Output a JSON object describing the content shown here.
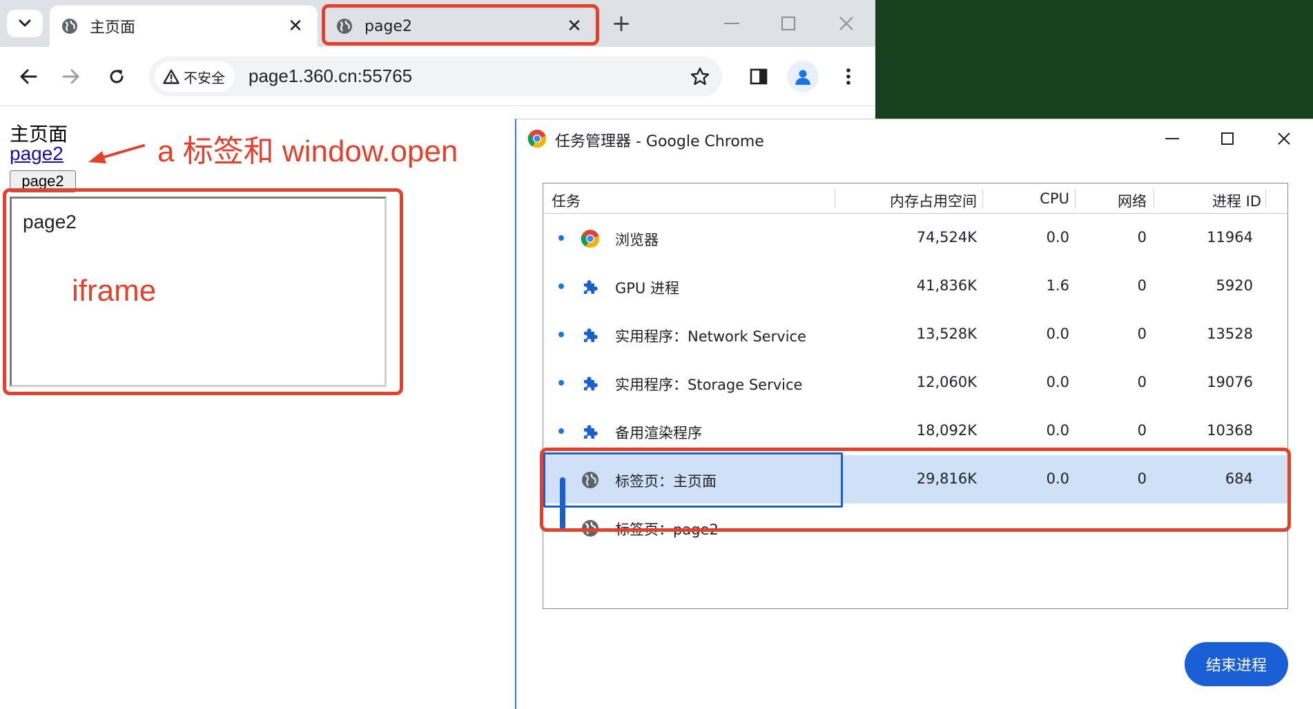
{
  "browser": {
    "tabs": [
      {
        "title": "主页面",
        "close": "✕"
      },
      {
        "title": "page2",
        "close": "✕"
      }
    ],
    "new_tab": "+",
    "security_label": "不安全",
    "url": "page1.360.cn:55765"
  },
  "page": {
    "heading": "主页面",
    "link_text": "page2",
    "button_label": "page2",
    "iframe_content": "page2"
  },
  "annotations": {
    "arrow_label": "a 标签和 window.open",
    "iframe_label": "iframe",
    "color": "#e2412c"
  },
  "task_manager": {
    "title": "任务管理器 - Google Chrome",
    "columns": [
      "任务",
      "内存占用空间",
      "CPU",
      "网络",
      "进程 ID"
    ],
    "rows": [
      {
        "icon": "chrome-icon",
        "task": "浏览器",
        "memory": "74,524K",
        "cpu": "0.0",
        "network": "0",
        "pid": "11964"
      },
      {
        "icon": "puzzle-icon",
        "task": "GPU 进程",
        "memory": "41,836K",
        "cpu": "1.6",
        "network": "0",
        "pid": "5920"
      },
      {
        "icon": "puzzle-icon",
        "task": "实用程序：Network Service",
        "memory": "13,528K",
        "cpu": "0.0",
        "network": "0",
        "pid": "13528"
      },
      {
        "icon": "puzzle-icon",
        "task": "实用程序：Storage Service",
        "memory": "12,060K",
        "cpu": "0.0",
        "network": "0",
        "pid": "19076"
      },
      {
        "icon": "puzzle-icon",
        "task": "备用渲染程序",
        "memory": "18,092K",
        "cpu": "0.0",
        "network": "0",
        "pid": "10368"
      },
      {
        "icon": "globe-icon",
        "task": "标签页：主页面",
        "memory": "29,816K",
        "cpu": "0.0",
        "network": "0",
        "pid": "684"
      },
      {
        "icon": "globe-icon",
        "task": "标签页：page2",
        "memory": "",
        "cpu": "",
        "network": "",
        "pid": ""
      }
    ],
    "selected_row": 5,
    "end_process_label": "结束进程"
  },
  "colors": {
    "accent_blue": "#1b5fd6",
    "selection": "#cfe0f7",
    "desktop_green": "#17401c"
  }
}
